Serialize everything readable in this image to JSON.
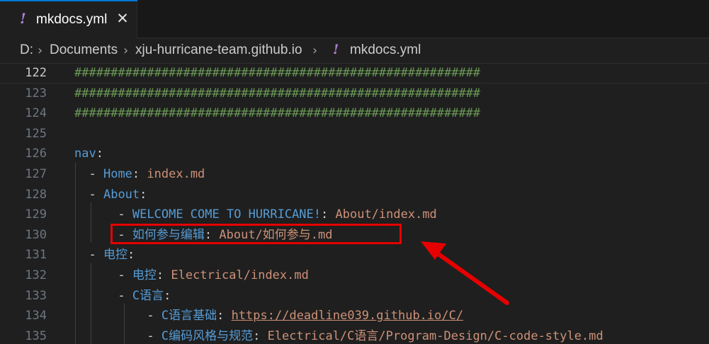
{
  "tab": {
    "icon": "!",
    "label": "mkdocs.yml",
    "close": "✕"
  },
  "breadcrumbs": {
    "drive": "D:",
    "folder1": "Documents",
    "folder2": "xju-hurricane-team.github.io",
    "file_icon": "!",
    "file": "mkdocs.yml",
    "separator": "›"
  },
  "lines": [
    {
      "num": "122",
      "comment": "########################################################"
    },
    {
      "num": "123",
      "comment": "########################################################"
    },
    {
      "num": "124",
      "comment": "########################################################"
    },
    {
      "num": "125"
    },
    {
      "num": "126",
      "key": "nav",
      "colon": ":"
    },
    {
      "num": "127",
      "dash": "- ",
      "key": "Home",
      "colon": ": ",
      "value": "index.md"
    },
    {
      "num": "128",
      "dash": "- ",
      "key": "About",
      "colon": ":"
    },
    {
      "num": "129",
      "dash": "- ",
      "key": "WELCOME COME TO HURRICANE!",
      "colon": ": ",
      "value": "About/index.md"
    },
    {
      "num": "130",
      "dash": "- ",
      "key": "如何参与编辑",
      "colon": ": ",
      "value": "About/如何参与.md"
    },
    {
      "num": "131",
      "dash": "- ",
      "key": "电控",
      "colon": ":"
    },
    {
      "num": "132",
      "dash": "- ",
      "key": "电控",
      "colon": ": ",
      "value": "Electrical/index.md"
    },
    {
      "num": "133",
      "dash": "- ",
      "key": "C语言",
      "colon": ":"
    },
    {
      "num": "134",
      "dash": "- ",
      "key": "C语言基础",
      "colon": ": ",
      "url": "https://deadline039.github.io/C/"
    },
    {
      "num": "135",
      "dash": "- ",
      "key": "C编码风格与规范",
      "colon": ": ",
      "value": "Electrical/C语言/Program-Design/C-code-style.md"
    }
  ],
  "colors": {
    "highlight_box": "#e60000",
    "arrow": "#e60000",
    "key": "#569cd6",
    "value": "#ce9178",
    "comment": "#6a9955"
  }
}
